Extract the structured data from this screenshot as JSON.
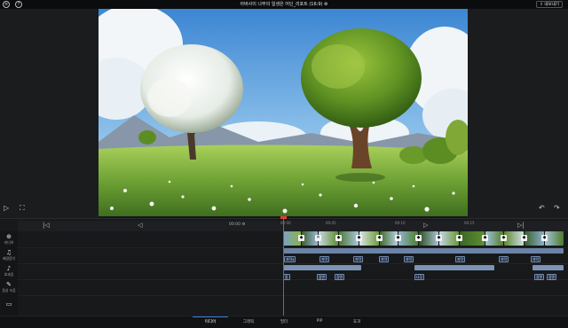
{
  "topbar": {
    "title": "아버사이 나무의 일생은 어딘_리포트 (16:9) ⚙",
    "export_label": "⇪ 내보내기",
    "left_icon": "help-icon"
  },
  "preview": {
    "play_icon": "play-icon",
    "fullscreen_icon": "fullscreen-icon",
    "undo_icon": "undo-icon",
    "redo_icon": "redo-icon"
  },
  "timeline": {
    "time_display": "00:00 ⚙",
    "ruler_labels": [
      "00:00",
      "00:05",
      "00:10",
      "00:15"
    ],
    "tools": [
      {
        "icon": "⊕",
        "label": "미디어"
      },
      {
        "icon": "♫",
        "label": "배경음악"
      },
      {
        "icon": "♪",
        "label": "효과음"
      },
      {
        "icon": "✎",
        "label": "음성 녹음"
      },
      {
        "icon": "▭",
        "label": ""
      }
    ],
    "caption_tags_row1": [
      "자막4",
      "자막",
      "자막",
      "자막",
      "자막",
      "자막",
      "자막",
      "자막"
    ],
    "caption_tags_row2": [
      "",
      "",
      "",
      "",
      "",
      "",
      "",
      ""
    ],
    "caption_tags_row3": [
      "동",
      "장면",
      "장면",
      "나무",
      "장면",
      "장면"
    ]
  },
  "bottom_tabs": [
    "미디어",
    "그래픽",
    "필터",
    "PIP",
    "효과"
  ],
  "colors": {
    "accent": "#3d7fe0",
    "playhead": "#e23a3a",
    "track_bar": "#6b83a6"
  }
}
